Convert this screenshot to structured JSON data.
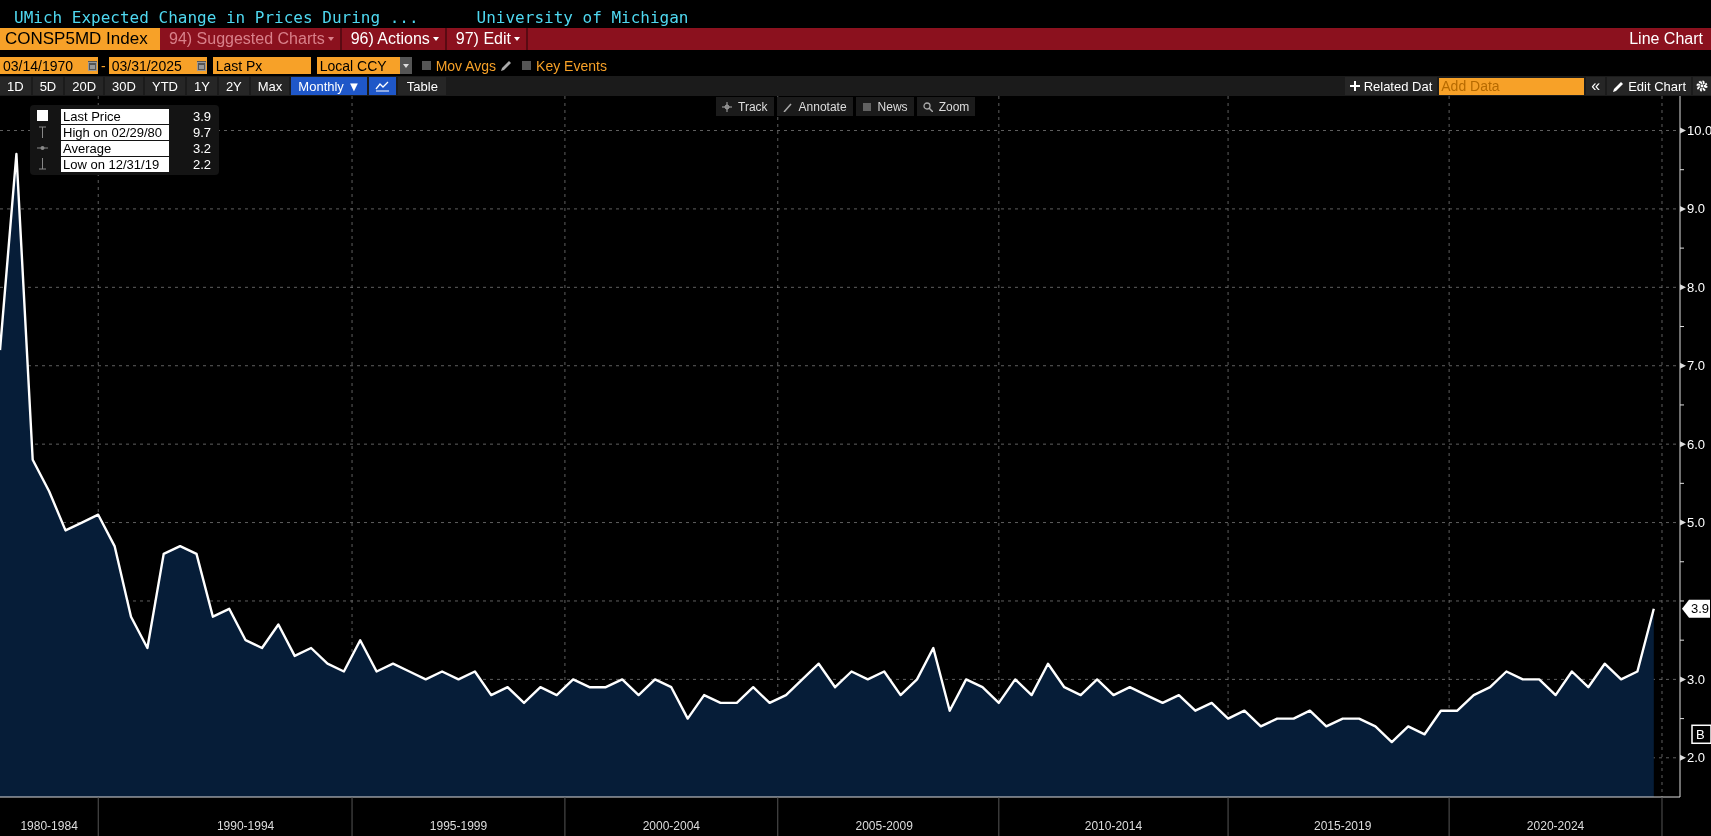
{
  "header": {
    "title": "UMich Expected Change in Prices During ...",
    "source": "University of Michigan"
  },
  "command_bar": {
    "ticker": "CONSP5MD Index",
    "menus": [
      {
        "label": "94) Suggested Charts",
        "disabled": true
      },
      {
        "label": "96) Actions",
        "disabled": false
      },
      {
        "label": "97) Edit",
        "disabled": false
      }
    ],
    "view": "Line Chart"
  },
  "settings": {
    "start_date": "03/14/1970",
    "separator": "-",
    "end_date": "03/31/2025",
    "field": "Last Px",
    "currency": "Local CCY",
    "options": [
      {
        "label": "Mov Avgs",
        "checked": false,
        "editable": true
      },
      {
        "label": "Key Events",
        "checked": false,
        "editable": false
      }
    ]
  },
  "periods": [
    {
      "label": "1D",
      "selected": false
    },
    {
      "label": "5D",
      "selected": false
    },
    {
      "label": "20D",
      "selected": false
    },
    {
      "label": "30D",
      "selected": false
    },
    {
      "label": "YTD",
      "selected": false
    },
    {
      "label": "1Y",
      "selected": false
    },
    {
      "label": "2Y",
      "selected": false
    },
    {
      "label": "Max",
      "selected": false
    },
    {
      "label": "Monthly ▼",
      "selected": true
    }
  ],
  "view_buttons": [
    {
      "kind": "chart",
      "selected": true
    },
    {
      "kind": "table",
      "label": "Table",
      "selected": false
    }
  ],
  "right_tools": {
    "related": "Related Dat",
    "add_placeholder": "Add Data",
    "collapse": "«",
    "edit": "Edit Chart"
  },
  "chart_tools": [
    {
      "kind": "track",
      "label": "Track"
    },
    {
      "kind": "annotate",
      "label": "Annotate"
    },
    {
      "kind": "news",
      "label": "News"
    },
    {
      "kind": "zoom",
      "label": "Zoom"
    }
  ],
  "legend": [
    {
      "kind": "last",
      "value": "3.9"
    },
    {
      "kind": "high",
      "label": "High on 02/29/80",
      "value": "9.7"
    },
    {
      "kind": "average",
      "label": "Average",
      "value": "3.2"
    },
    {
      "kind": "low",
      "label": "Low on 12/31/19",
      "value": "2.2"
    }
  ],
  "last_tag": "3.9",
  "side_marker": "B",
  "chart_data": {
    "type": "area",
    "grid": true,
    "ylim": [
      1.5,
      10.44
    ],
    "yticks": [
      {
        "value": 2,
        "label": "2.0"
      },
      {
        "value": 3,
        "label": "3.0"
      },
      {
        "value": 5,
        "label": "5.0"
      },
      {
        "value": 6,
        "label": "6.0"
      },
      {
        "value": 7,
        "label": "7.0"
      },
      {
        "value": 8,
        "label": "8.0"
      },
      {
        "value": 9,
        "label": "9.0"
      },
      {
        "value": 10,
        "label": "10.0"
      }
    ],
    "categories": [
      null,
      null,
      null,
      "1980-1984",
      null,
      null,
      null,
      null,
      null,
      null,
      null,
      null,
      null,
      null,
      null,
      "1990-1994",
      null,
      null,
      null,
      null,
      null,
      null,
      null,
      null,
      null,
      null,
      null,
      null,
      "1995-1999",
      null,
      null,
      null,
      null,
      null,
      null,
      null,
      null,
      null,
      null,
      null,
      null,
      "2000-2004",
      null,
      null,
      null,
      null,
      null,
      null,
      null,
      null,
      null,
      null,
      null,
      null,
      "2005-2009",
      null,
      null,
      null,
      null,
      null,
      null,
      null,
      null,
      null,
      null,
      null,
      null,
      null,
      "2010-2014",
      null,
      null,
      null,
      null,
      null,
      null,
      null,
      null,
      null,
      null,
      null,
      null,
      null,
      "2015-2019",
      null,
      null,
      null,
      null,
      null,
      null,
      null,
      null,
      null,
      null,
      null,
      null,
      "2020-2024",
      null,
      null,
      null,
      null,
      null,
      null
    ],
    "series": [
      {
        "name": "Last Price",
        "color": "#ffffff",
        "values": [
          7.2,
          9.7,
          5.8,
          5.4,
          4.9,
          5.0,
          5.1,
          4.7,
          3.8,
          3.4,
          4.6,
          4.7,
          4.6,
          3.8,
          3.9,
          3.5,
          3.4,
          3.7,
          3.3,
          3.4,
          3.2,
          3.1,
          3.5,
          3.1,
          3.2,
          3.1,
          3.0,
          3.1,
          3.0,
          3.1,
          2.8,
          2.9,
          2.7,
          2.9,
          2.8,
          3.0,
          2.9,
          2.9,
          3.0,
          2.8,
          3.0,
          2.9,
          2.5,
          2.8,
          2.7,
          2.7,
          2.9,
          2.7,
          2.8,
          3.0,
          3.2,
          2.9,
          3.1,
          3.0,
          3.1,
          2.8,
          3.0,
          3.4,
          2.6,
          3.0,
          2.9,
          2.7,
          3.0,
          2.8,
          3.2,
          2.9,
          2.8,
          3.0,
          2.8,
          2.9,
          2.8,
          2.7,
          2.8,
          2.6,
          2.7,
          2.5,
          2.6,
          2.4,
          2.5,
          2.5,
          2.6,
          2.4,
          2.5,
          2.5,
          2.4,
          2.2,
          2.4,
          2.3,
          2.6,
          2.6,
          2.8,
          2.9,
          3.1,
          3.0,
          3.0,
          2.8,
          3.1,
          2.9,
          3.2,
          3.0,
          3.1,
          3.9
        ]
      }
    ]
  }
}
